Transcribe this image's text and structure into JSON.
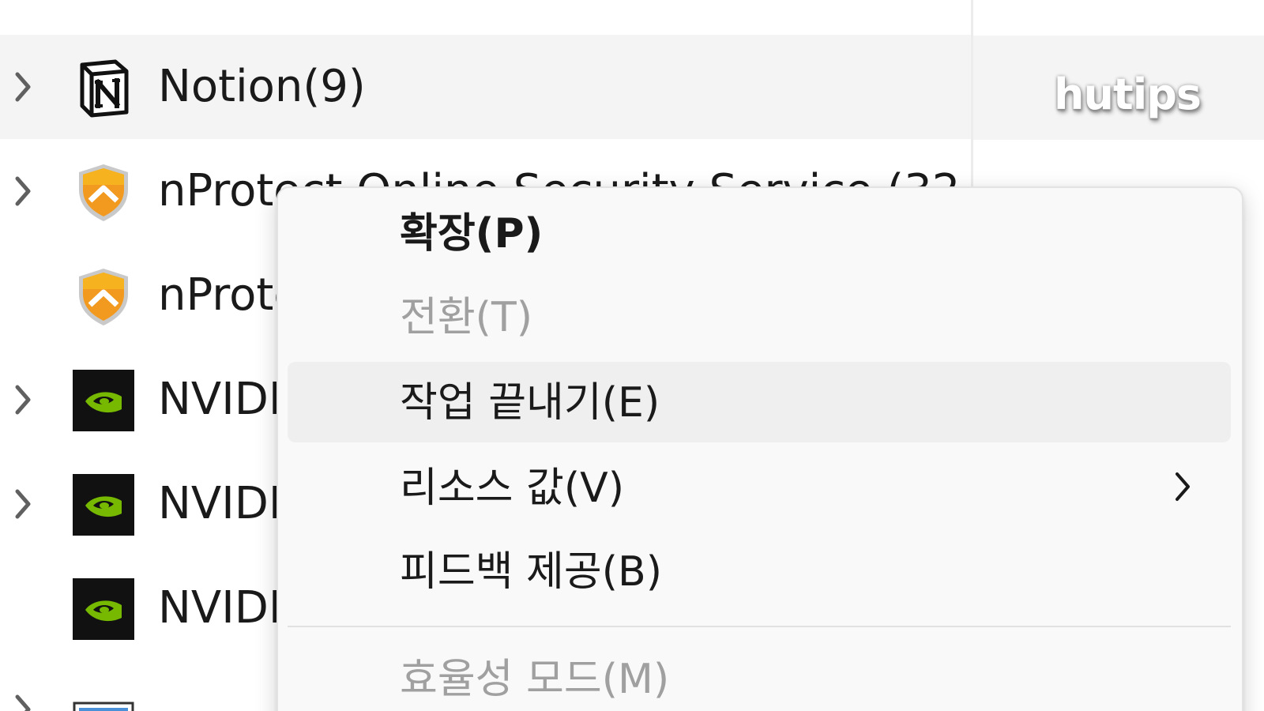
{
  "process_list": {
    "rows": [
      {
        "label": "Notion(9)",
        "icon": "notion-icon",
        "expandable": true,
        "selected": true
      },
      {
        "label": "nProtect Online Security Service (32",
        "icon": "shield-icon",
        "expandable": true,
        "selected": false
      },
      {
        "label": "nProtect",
        "icon": "shield-icon",
        "expandable": false,
        "selected": false
      },
      {
        "label": "NVIDIA",
        "icon": "nvidia-icon",
        "expandable": true,
        "selected": false
      },
      {
        "label": "NVIDIA",
        "icon": "nvidia-icon",
        "expandable": true,
        "selected": false
      },
      {
        "label": "NVIDIA",
        "icon": "nvidia-icon",
        "expandable": false,
        "selected": false
      }
    ]
  },
  "watermark": {
    "text": "hutips"
  },
  "context_menu": {
    "items": [
      {
        "label": "확장(P)",
        "state": "default",
        "bold": true
      },
      {
        "label": "전환(T)",
        "state": "disabled"
      },
      {
        "label": "작업 끝내기(E)",
        "state": "hover"
      },
      {
        "label": "리소스 값(V)",
        "state": "default",
        "has_submenu": true
      },
      {
        "label": "피드백 제공(B)",
        "state": "default"
      },
      {
        "label": "효율성 모드(M)",
        "state": "disabled"
      }
    ]
  },
  "colors": {
    "selected_row": "#f4f4f4",
    "menu_background": "#f9f9f9",
    "menu_hover": "#efefef",
    "disabled_text": "#a0a0a0",
    "nvidia_green": "#76b900",
    "shield_orange": "#f29a1f"
  }
}
